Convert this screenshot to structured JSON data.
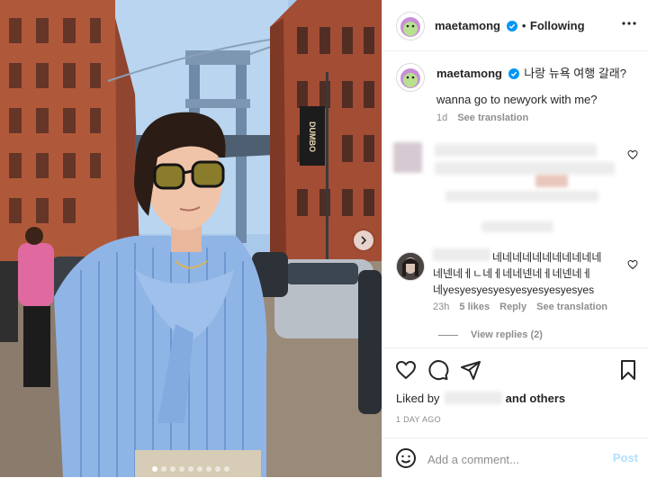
{
  "post": {
    "author": "maetamong",
    "follow_separator": "•",
    "follow_status": "Following",
    "caption_korean": "나랑 뉴욕 여행 갈래?",
    "caption_english": "wanna go to newyork with me?",
    "caption_age": "1d",
    "see_translation": "See translation",
    "photo_sign_text": "DUMBO"
  },
  "comments": [
    {
      "text_line1": "네네네네네네네네네네네",
      "text_line2": "네넨네ㅔㄴ네ㅔ네네넨네ㅔ네넨네ㅔ",
      "text_line3": "네yesyesyesyesyesyesyesyesyes",
      "age": "23h",
      "likes": "5 likes",
      "reply": "Reply",
      "see_translation": "See translation",
      "view_replies": "View replies (2)"
    }
  ],
  "footer": {
    "liked_by_prefix": "Liked by",
    "liked_by_suffix": "and others",
    "date": "1 DAY AGO",
    "comment_placeholder": "Add a comment...",
    "post_label": "Post"
  },
  "colors": {
    "verified_blue": "#0095f6",
    "muted_text": "#8e8e8e",
    "divider": "#efefef",
    "post_disabled": "#b2dffc"
  },
  "icons": {
    "verified": "verified-badge-icon",
    "more": "more-options-icon",
    "like": "heart-icon",
    "comment": "comment-bubble-icon",
    "share": "paper-plane-icon",
    "save": "bookmark-icon",
    "emoji": "emoji-icon",
    "next": "chevron-right-icon"
  },
  "carousel": {
    "slide_count": 9,
    "active_index": 0
  }
}
